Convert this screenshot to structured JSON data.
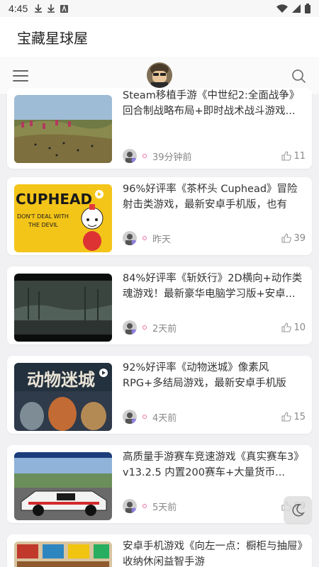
{
  "status_bar": {
    "time": "4:45"
  },
  "app_bar": {
    "title": "宝藏星球屋"
  },
  "posts": [
    {
      "text": "Steam移植手游《中世纪2:全面战争》回合制战略布局+即时战术战斗游戏...",
      "time": "39分钟前",
      "likes": "11",
      "thumb": "medieval-battle"
    },
    {
      "text": "96%好评率《茶杯头 Cuphead》冒险射击类游戏，最新安卓手机版，也有电...",
      "time": "昨天",
      "likes": "39",
      "thumb": "cuphead"
    },
    {
      "text": "84%好评率《斩妖行》2D横向+动作类魂游戏！最新豪华电脑学习版+安卓...",
      "time": "2天前",
      "likes": "10",
      "thumb": "dark-forest"
    },
    {
      "text": "92%好评率《动物迷城》像素风RPG+多结局游戏，最新安卓手机版+...",
      "time": "4天前",
      "likes": "15",
      "thumb": "animal-cats"
    },
    {
      "text": "高质量手游赛车竞速游戏《真实赛车3》v13.2.5 内置200赛车+大量货币...",
      "time": "5天前",
      "likes": "69",
      "thumb": "race-car"
    },
    {
      "text": "安卓手机游戏《向左一点：橱柜与抽屉》收纳休闲益智手游",
      "time": "",
      "likes": "",
      "thumb": "drawers"
    }
  ],
  "colors": {
    "accent_dot": "#e870a8",
    "meta_text": "#888888",
    "page_bg": "#f1f1f3"
  }
}
